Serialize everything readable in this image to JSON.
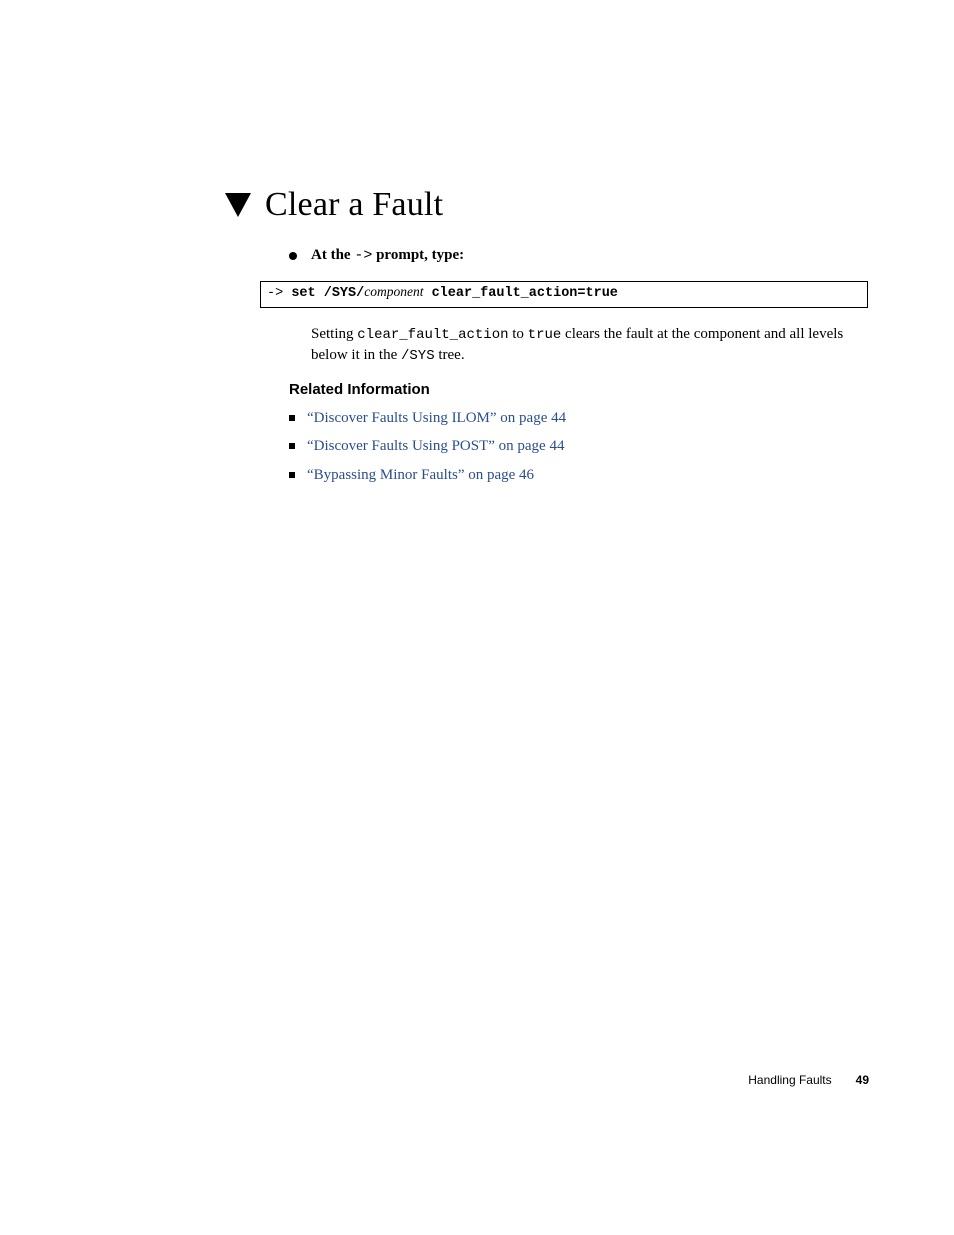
{
  "heading": "Clear a Fault",
  "step": {
    "prefix": "At the ",
    "code": "->",
    "suffix": " prompt, type:"
  },
  "codebox": {
    "prompt": "-> ",
    "cmd1": "set /SYS/",
    "component": "component",
    "cmd2": " clear_fault_action=true"
  },
  "paragraph": {
    "t1": "Setting ",
    "m1": "clear_fault_action",
    "t2": " to ",
    "m2": "true",
    "t3": " clears the fault at the component and all levels below it in the ",
    "m3": "/SYS",
    "t4": " tree."
  },
  "related_heading": "Related Information",
  "related": [
    {
      "link": "“Discover Faults Using ILOM” on page 44"
    },
    {
      "link": "“Discover Faults Using POST” on page 44"
    },
    {
      "link": "“Bypassing Minor Faults” on page 46"
    }
  ],
  "footer": {
    "section": "Handling Faults",
    "page": "49"
  }
}
